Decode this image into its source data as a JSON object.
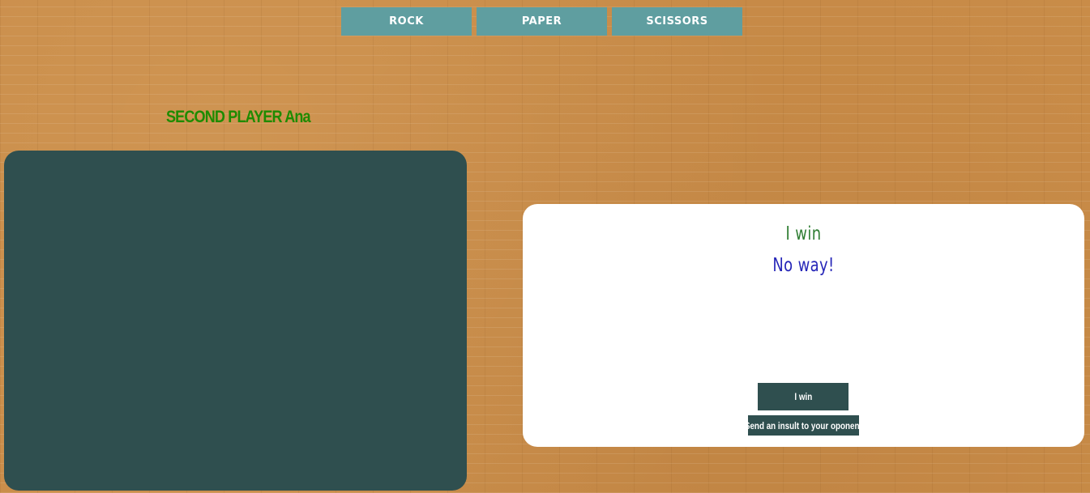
{
  "choices": [
    {
      "label": "ROCK"
    },
    {
      "label": "PAPER"
    },
    {
      "label": "SCISSORS"
    }
  ],
  "player": {
    "title": "SECOND PLAYER Ana"
  },
  "chat": {
    "messages": [
      {
        "text": "I win",
        "from": "me",
        "color": "#2e7d32"
      },
      {
        "text": "No way!",
        "from": "opponent",
        "color": "#2626b8"
      }
    ],
    "win_button_label": "I win",
    "insult_button_label": "Send an insult to your oponent"
  },
  "colors": {
    "background": "#c98c48",
    "choice_button": "#5f9ea0",
    "board": "#2f4f4f",
    "player_title": "#1e8b00",
    "panel": "#ffffff"
  }
}
